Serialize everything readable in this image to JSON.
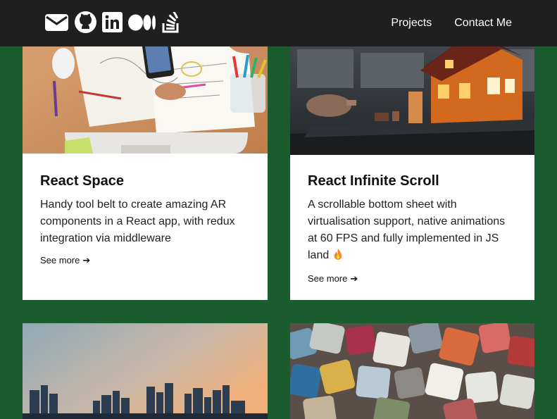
{
  "navbar": {
    "icons": [
      "envelope-icon",
      "github-icon",
      "linkedin-icon",
      "medium-icon",
      "stackoverflow-icon"
    ],
    "links": [
      "Projects",
      "Contact Me"
    ]
  },
  "colors": {
    "page_bg": "#1a5c2e",
    "navbar_bg": "#1f1f1f",
    "card_bg": "#ffffff"
  },
  "cards": [
    {
      "title": "React Space",
      "description": "Handy tool belt to create amazing AR components in a React app, with redux integration via middleware",
      "link": "See more",
      "image": "desk-sketching-photo"
    },
    {
      "title": "React Infinite Scroll",
      "description": "A scrollable bottom sheet with virtualisation support, native animations at 60 FPS and fully implemented in JS land",
      "emoji": "🔥",
      "link": "See more",
      "image": "miniature-house-photo"
    },
    {
      "image": "city-skyline-photo"
    },
    {
      "image": "colorful-stones-photo"
    }
  ]
}
